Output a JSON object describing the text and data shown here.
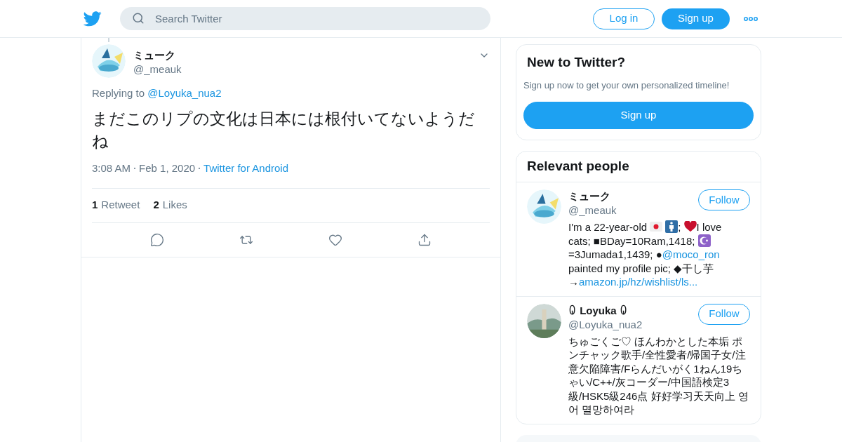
{
  "header": {
    "search": {
      "placeholder": "Search Twitter"
    },
    "login": "Log in",
    "signup": "Sign up"
  },
  "tweet": {
    "name": "ミューク",
    "handle": "@_meauk",
    "replying_label": "Replying to",
    "replying_to": "@Loyuka_nua2",
    "text": "まだこのリプの文化は日本には根付いてないようだね",
    "time": "3:08 AM",
    "date": "Feb 1, 2020",
    "source": "Twitter for Android",
    "stats": [
      {
        "count": "1",
        "label": "Retweet"
      },
      {
        "count": "2",
        "label": "Likes"
      }
    ],
    "actions": [
      {
        "kind": "reply"
      },
      {
        "kind": "retweet"
      },
      {
        "kind": "like"
      },
      {
        "kind": "share"
      }
    ]
  },
  "new_to_twitter": {
    "title": "New to Twitter?",
    "text": "Sign up now to get your own personalized timeline!",
    "button": "Sign up"
  },
  "relevant_people": {
    "title": "Relevant people",
    "people": [
      {
        "name": "ミューク",
        "handle": "@_meauk",
        "follow": "Follow",
        "bio": [
          {
            "kind": "text",
            "text": "I'm a 22-year-old "
          },
          {
            "kind": "flag"
          },
          {
            "kind": "man"
          },
          {
            "kind": "text",
            "text": "; "
          },
          {
            "kind": "heart"
          },
          {
            "kind": "text",
            "text": "I love cats; ■BDay=10Ram,1418; "
          },
          {
            "kind": "moon"
          },
          {
            "kind": "text",
            "text": " =3Jumada1,1439; ●"
          },
          {
            "kind": "link",
            "text": "@moco_ron"
          },
          {
            "kind": "text",
            "text": " painted my profile pic; ◆干し芋 →"
          },
          {
            "kind": "link",
            "text": "amazon.jp/hz/wishlist/ls..."
          }
        ]
      },
      {
        "name": "ꐎ Loyuka ꐎ",
        "handle": "@Loyuka_nua2",
        "follow": "Follow",
        "bio": [
          {
            "kind": "text",
            "text": "ちゅごくご♡ ほんわかとした本垢 ポンチャック歌手/全性愛者/帰国子女/注意欠陥障害/Fらんだいがく1ねん19ちゃい/C++/灰コーダー/中国語検定3級/HSK5級246点 好好学习天天向上 영어 멸망하여라"
          }
        ]
      }
    ]
  }
}
